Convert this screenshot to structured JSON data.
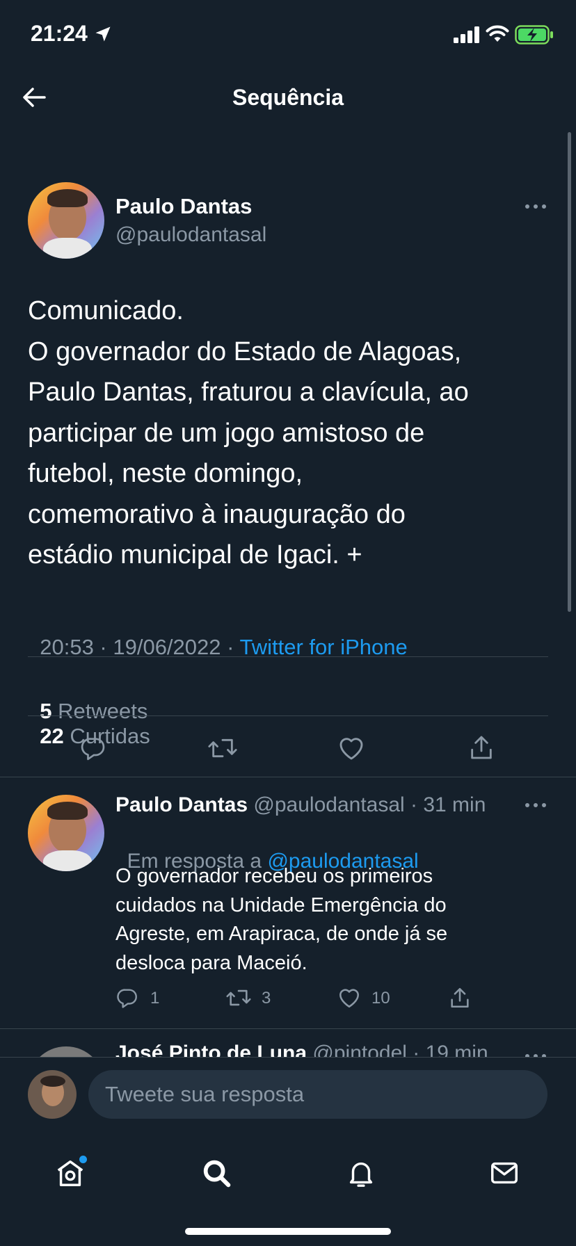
{
  "status_bar": {
    "time": "21:24"
  },
  "header": {
    "title": "Sequência"
  },
  "main_tweet": {
    "author_name": "Paulo Dantas",
    "author_handle": "@paulodantasal",
    "text_lines": [
      "Comunicado.",
      "O governador do Estado de Alagoas,",
      "Paulo Dantas, fraturou a clavícula, ao",
      "participar de um jogo amistoso de",
      "futebol, neste domingo,",
      "comemorativo à inauguração do",
      "estádio municipal de Igaci. +"
    ],
    "timestamp": "20:53 · 19/06/2022 · ",
    "source": "Twitter for iPhone",
    "retweets_count": "5",
    "retweets_label": "Retweets",
    "likes_count": "22",
    "likes_label": "Curtidas"
  },
  "reply_tweet": {
    "author_name": "Paulo Dantas",
    "author_handle": "@paulodantasal",
    "time": "· 31 min",
    "replying_prefix": "Em resposta a ",
    "replying_to": "@paulodantasal",
    "text_lines": [
      "O governador recebeu os primeiros",
      "cuidados na Unidade Emergência do",
      "Agreste, em Arapiraca, de onde já se",
      "desloca para Maceió."
    ],
    "reply_count": "1",
    "retweet_count": "3",
    "like_count": "10"
  },
  "next_tweet": {
    "author_name": "José Pinto de Luna",
    "author_handle": "@pintodel",
    "time": "· 19 min"
  },
  "reply_bar": {
    "placeholder": "Tweete sua resposta"
  },
  "colors": {
    "background": "#15202b",
    "accent": "#1d9bf0",
    "muted": "#8b98a5",
    "divider": "#38444d"
  }
}
